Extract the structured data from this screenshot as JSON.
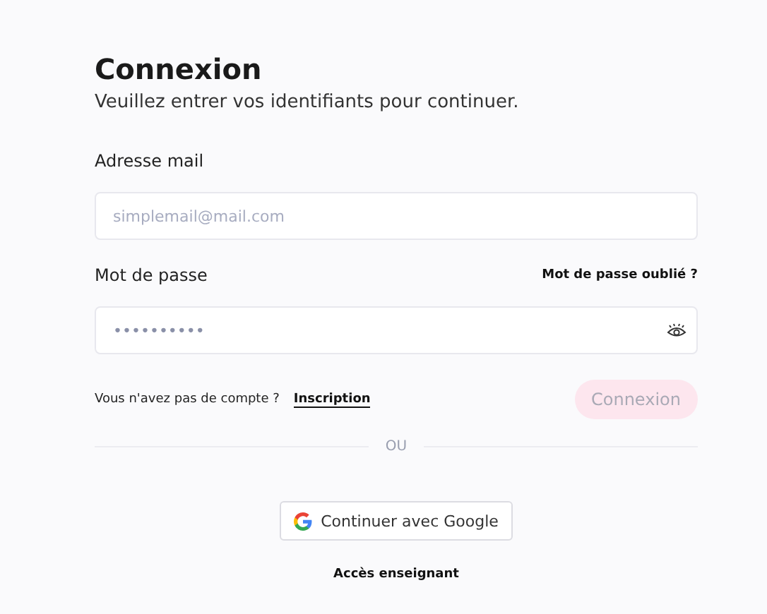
{
  "title": "Connexion",
  "subtitle": "Veuillez entrer vos identifiants pour continuer.",
  "email": {
    "label": "Adresse mail",
    "placeholder": "simplemail@mail.com"
  },
  "password": {
    "label": "Mot de passe",
    "forgot_link": "Mot de passe oublié ?",
    "value": "••••••••••"
  },
  "signup": {
    "prompt": "Vous n'avez pas de compte ?",
    "link": "Inscription"
  },
  "submit": {
    "label": "Connexion",
    "disabled": true
  },
  "divider": "OU",
  "google_button": "Continuer avec Google",
  "teacher_link": "Accès enseignant"
}
